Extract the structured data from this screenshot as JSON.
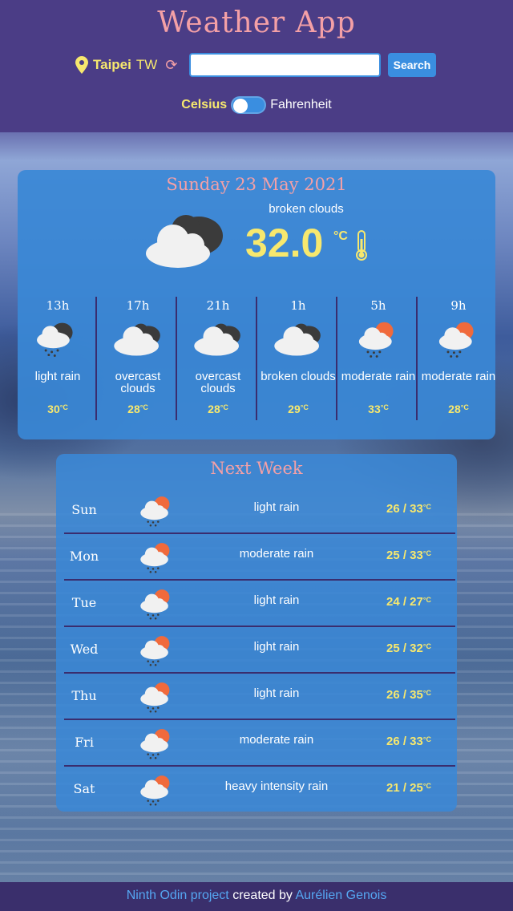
{
  "app": {
    "title": "Weather App"
  },
  "location": {
    "city": "Taipei",
    "country": "TW"
  },
  "search": {
    "value": "",
    "placeholder": "",
    "button_label": "Search"
  },
  "units": {
    "celsius_label": "Celsius",
    "fahrenheit_label": "Fahrenheit",
    "selected": "Celsius"
  },
  "current": {
    "date": "Sunday 23 May 2021",
    "description": "broken clouds",
    "temperature": "32.0",
    "unit": "°C",
    "icon": "broken-clouds"
  },
  "hourly": [
    {
      "time": "13h",
      "description": "light rain",
      "temp": "30",
      "icon": "rain-clouds"
    },
    {
      "time": "17h",
      "description": "overcast clouds",
      "temp": "28",
      "icon": "overcast-clouds"
    },
    {
      "time": "21h",
      "description": "overcast clouds",
      "temp": "28",
      "icon": "overcast-clouds"
    },
    {
      "time": "1h",
      "description": "broken clouds",
      "temp": "29",
      "icon": "broken-clouds"
    },
    {
      "time": "5h",
      "description": "moderate rain",
      "temp": "33",
      "icon": "sun-rain"
    },
    {
      "time": "9h",
      "description": "moderate rain",
      "temp": "28",
      "icon": "sun-rain"
    }
  ],
  "unit_small": "°C",
  "week": {
    "title": "Next Week",
    "days": [
      {
        "day": "Sun",
        "description": "light rain",
        "temp": "26 / 33",
        "icon": "sun-rain"
      },
      {
        "day": "Mon",
        "description": "moderate rain",
        "temp": "25 / 33",
        "icon": "sun-rain"
      },
      {
        "day": "Tue",
        "description": "light rain",
        "temp": "24 / 27",
        "icon": "sun-rain"
      },
      {
        "day": "Wed",
        "description": "light rain",
        "temp": "25 / 32",
        "icon": "sun-rain"
      },
      {
        "day": "Thu",
        "description": "light rain",
        "temp": "26 / 35",
        "icon": "sun-rain"
      },
      {
        "day": "Fri",
        "description": "moderate rain",
        "temp": "26 / 33",
        "icon": "sun-rain"
      },
      {
        "day": "Sat",
        "description": "heavy intensity rain",
        "temp": "21 / 25",
        "icon": "sun-rain"
      }
    ]
  },
  "footer": {
    "project": "Ninth Odin project",
    "created_by": " created by ",
    "author": "Aurélien Genois"
  },
  "colors": {
    "accent_pink": "#f4a0a6",
    "accent_yellow": "#f7e86e",
    "card_blue": "#3a88d6",
    "header_purple": "#4b3d86"
  }
}
